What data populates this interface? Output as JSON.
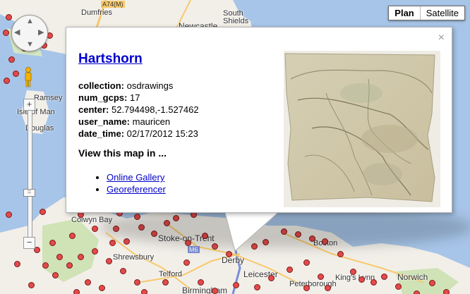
{
  "map": {
    "places": [
      {
        "key": "dumfries",
        "label": "Dumfries"
      },
      {
        "key": "newcastle",
        "label": "Newcastle"
      },
      {
        "key": "south_shields",
        "label": "South\nShields"
      },
      {
        "key": "ramsey",
        "label": "Ramsey"
      },
      {
        "key": "isle_of_man",
        "label": "Isle of Man"
      },
      {
        "key": "douglas",
        "label": "Douglas"
      },
      {
        "key": "colwyn_bay",
        "label": "Colwyn Bay"
      },
      {
        "key": "stoke",
        "label": "Stoke-on-Trent"
      },
      {
        "key": "shrewsbury",
        "label": "Shrewsbury"
      },
      {
        "key": "telford",
        "label": "Telford"
      },
      {
        "key": "derby",
        "label": "Derby"
      },
      {
        "key": "leicester",
        "label": "Leicester"
      },
      {
        "key": "peterborough",
        "label": "Peterborough"
      },
      {
        "key": "kings_lynn",
        "label": "King's Lynn"
      },
      {
        "key": "norwich",
        "label": "Norwich"
      },
      {
        "key": "birmingham",
        "label": "Birmingham"
      },
      {
        "key": "boston",
        "label": "Boston"
      }
    ],
    "road_labels": {
      "a74": "A74(M)",
      "m6": "M6"
    }
  },
  "map_type": {
    "plan": "Plan",
    "satellite": "Satellite",
    "selected": "Plan"
  },
  "controls": {
    "zoom_in": "+",
    "zoom_out": "−",
    "slider": "="
  },
  "infowindow": {
    "close": "×",
    "title": "Hartshorn",
    "fields": [
      {
        "label": "collection:",
        "value": "osdrawings"
      },
      {
        "label": "num_gcps:",
        "value": "17"
      },
      {
        "label": "center:",
        "value": "52.794498,-1.527462"
      },
      {
        "label": "user_name:",
        "value": "mauricen"
      },
      {
        "label": "date_time:",
        "value": "02/17/2012 15:23"
      }
    ],
    "view_heading": "View this map in ...",
    "links": [
      {
        "label": "Online Gallery"
      },
      {
        "label": "Georeferencer"
      }
    ]
  },
  "colors": {
    "water": "#a7c5e8",
    "land": "#f2efe9",
    "marker": "#e44a4a",
    "link": "#0000cc"
  }
}
